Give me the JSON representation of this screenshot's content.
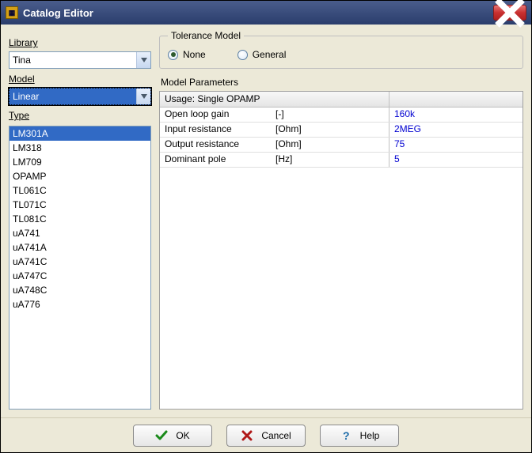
{
  "window": {
    "title": "Catalog Editor"
  },
  "labels": {
    "library": "Library",
    "model": "Model",
    "type": "Type",
    "tolerance_model": "Tolerance Model",
    "none": "None",
    "general": "General",
    "model_parameters": "Model Parameters"
  },
  "library_select": "Tina",
  "model_select": "Linear",
  "types": [
    "LM301A",
    "LM318",
    "LM709",
    "OPAMP",
    "TL061C",
    "TL071C",
    "TL081C",
    "uA741",
    "uA741A",
    "uA741C",
    "uA747C",
    "uA748C",
    "uA776"
  ],
  "selected_type_index": 0,
  "tolerance": "None",
  "param_header": "Usage: Single OPAMP",
  "params": [
    {
      "name": "Open loop gain",
      "unit": "[-]",
      "value": "160k"
    },
    {
      "name": "Input resistance",
      "unit": "[Ohm]",
      "value": "2MEG"
    },
    {
      "name": "Output resistance",
      "unit": "[Ohm]",
      "value": "75"
    },
    {
      "name": "Dominant pole",
      "unit": "[Hz]",
      "value": "5"
    }
  ],
  "buttons": {
    "ok": "OK",
    "cancel": "Cancel",
    "help": "Help"
  }
}
